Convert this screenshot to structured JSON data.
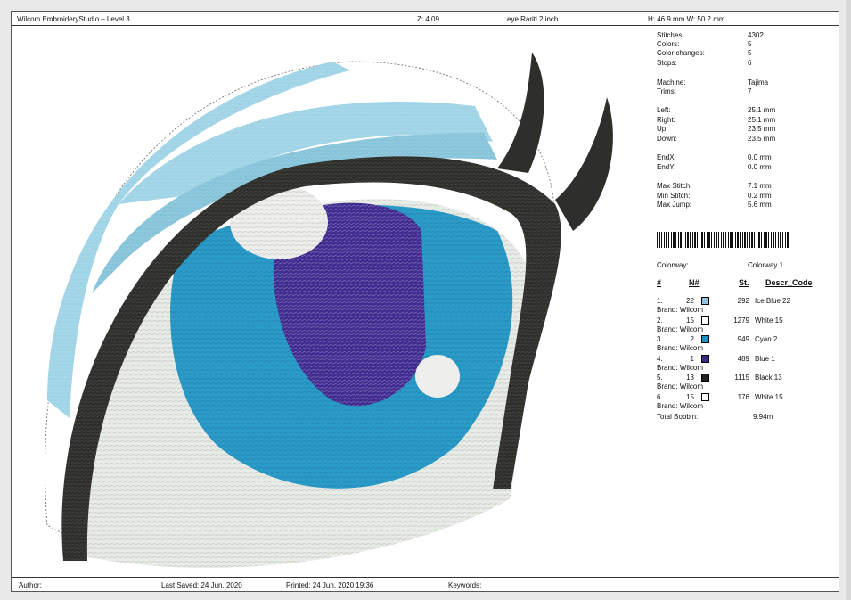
{
  "header": {
    "app_title": "Wilcom EmbroideryStudio – Level 3",
    "zoom": "Z: 4.09",
    "design_name": "eye Rariti 2 inch",
    "size": "H: 46.9 mm   W: 50.2 mm"
  },
  "stats": [
    {
      "label": "Stitches:",
      "value": "4302"
    },
    {
      "label": "Colors:",
      "value": "5"
    },
    {
      "label": "Color changes:",
      "value": "5"
    },
    {
      "label": "Stops:",
      "value": "6"
    },
    {
      "label": "Machine:",
      "value": "Tajima"
    },
    {
      "label": "Trims:",
      "value": "7"
    },
    {
      "label": "Left:",
      "value": "25.1 mm"
    },
    {
      "label": "Right:",
      "value": "25.1 mm"
    },
    {
      "label": "Up:",
      "value": "23.5 mm"
    },
    {
      "label": "Down:",
      "value": "23.5 mm"
    },
    {
      "label": "EndX:",
      "value": "0.0 mm"
    },
    {
      "label": "EndY:",
      "value": "0.0 mm"
    },
    {
      "label": "Max Stitch:",
      "value": "7.1 mm"
    },
    {
      "label": "Min Stitch:",
      "value": "0.2 mm"
    },
    {
      "label": "Max Jump:",
      "value": "5.6 mm"
    }
  ],
  "colorway": {
    "label": "Colorway:",
    "value": "Colorway 1"
  },
  "table_headers": {
    "index": "#",
    "number": "N#",
    "stitches": "St.",
    "descr": "Descr_Code"
  },
  "colors": [
    {
      "idx": "1.",
      "num": "22",
      "swatch": "#8fc3e3",
      "st": "292",
      "descr": "Ice Blue 22",
      "brand": "Brand: Wilcom"
    },
    {
      "idx": "2.",
      "num": "15",
      "swatch": "#ffffff",
      "st": "1279",
      "descr": "White 15",
      "brand": "Brand: Wilcom"
    },
    {
      "idx": "3.",
      "num": "2",
      "swatch": "#1f8fc9",
      "st": "949",
      "descr": "Cyan 2",
      "brand": "Brand: Wilcom"
    },
    {
      "idx": "4.",
      "num": "1",
      "swatch": "#3b2a8c",
      "st": "489",
      "descr": "Blue 1",
      "brand": "Brand: Wilcom"
    },
    {
      "idx": "5.",
      "num": "13",
      "swatch": "#222222",
      "st": "1115",
      "descr": "Black 13",
      "brand": "Brand: Wilcom"
    },
    {
      "idx": "6.",
      "num": "15",
      "swatch": "#ffffff",
      "st": "176",
      "descr": "White 15",
      "brand": "Brand: Wilcom"
    }
  ],
  "total_bobbin": {
    "label": "Total Bobbin:",
    "value": "9.94m"
  },
  "footer": {
    "author": "Author:",
    "last_saved": "Last Saved: 24 Jun, 2020",
    "printed": "Printed: 24 Jun, 2020 19:36",
    "keywords": "Keywords:"
  }
}
